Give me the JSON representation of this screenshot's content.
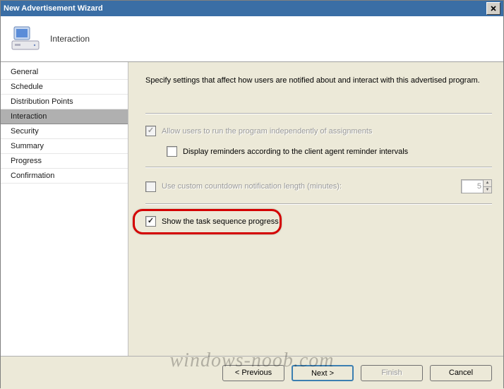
{
  "window": {
    "title": "New Advertisement Wizard"
  },
  "header": {
    "page_title": "Interaction"
  },
  "sidebar": {
    "items": [
      {
        "label": "General"
      },
      {
        "label": "Schedule"
      },
      {
        "label": "Distribution Points"
      },
      {
        "label": "Interaction",
        "selected": true
      },
      {
        "label": "Security"
      },
      {
        "label": "Summary"
      },
      {
        "label": "Progress"
      },
      {
        "label": "Confirmation"
      }
    ]
  },
  "content": {
    "intro": "Specify settings that affect how users are notified about and interact with this advertised program.",
    "options": {
      "allow_independent": {
        "label": "Allow users to run the program independently of assignments",
        "checked": true,
        "disabled": true
      },
      "display_reminders": {
        "label": "Display reminders according to the client agent reminder intervals",
        "checked": false,
        "disabled": false
      },
      "custom_countdown": {
        "label": "Use custom countdown notification length (minutes):",
        "checked": false,
        "disabled": true,
        "value": "5"
      },
      "show_progress": {
        "label": "Show the task sequence progress",
        "checked": true,
        "disabled": false,
        "highlighted": true
      }
    }
  },
  "buttons": {
    "previous": "< Previous",
    "next": "Next >",
    "finish": "Finish",
    "cancel": "Cancel"
  },
  "watermark": "windows-noob.com"
}
